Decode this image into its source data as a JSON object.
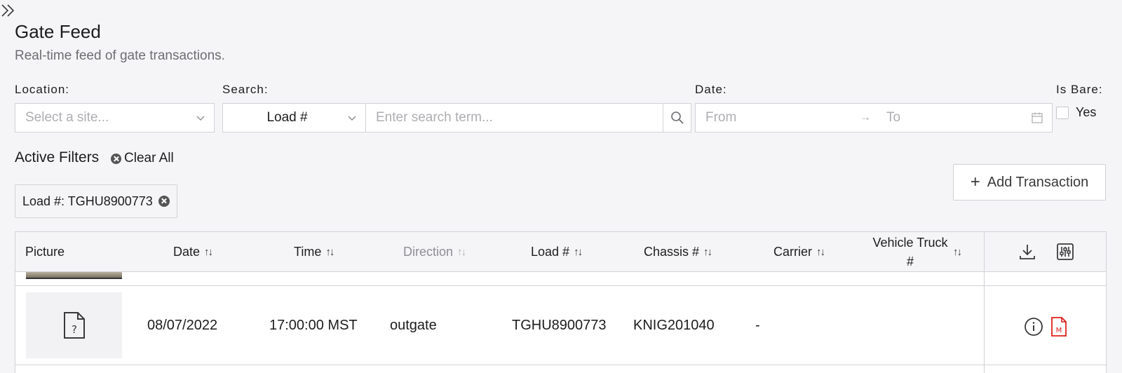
{
  "page": {
    "title": "Gate Feed",
    "subtitle": "Real-time feed of gate transactions."
  },
  "filters": {
    "location_label": "Location:",
    "location_placeholder": "Select a site...",
    "search_label": "Search:",
    "search_type": "Load #",
    "search_placeholder": "Enter search term...",
    "date_label": "Date:",
    "date_from": "From",
    "date_arrow": "→",
    "date_to": "To",
    "is_bare_label": "Is Bare:",
    "is_bare_option": "Yes"
  },
  "active_filters": {
    "title": "Active Filters",
    "clear_all": "Clear All",
    "chips": [
      "Load #: TGHU8900773"
    ]
  },
  "actions": {
    "add_transaction": "Add Transaction"
  },
  "table": {
    "columns": [
      "Picture",
      "Date",
      "Time",
      "Direction",
      "Load #",
      "Chassis #",
      "Carrier",
      "Vehicle Truck #"
    ],
    "rows": [
      {
        "date": "08/07/2022",
        "time": "17:00:00 MST",
        "direction": "outgate",
        "load": "TGHU8900773",
        "chassis": "KNIG201040",
        "carrier": "-",
        "vehicle_truck": ""
      }
    ]
  },
  "icons": {
    "sort": "sort-icon",
    "download": "download-icon",
    "column_settings": "sliders-icon",
    "info": "info-icon",
    "pdf": "pdf-icon",
    "missing_image": "missing-image-icon"
  },
  "colors": {
    "pdf_red": "#e0201a",
    "header_bg": "#f5f5f7"
  }
}
